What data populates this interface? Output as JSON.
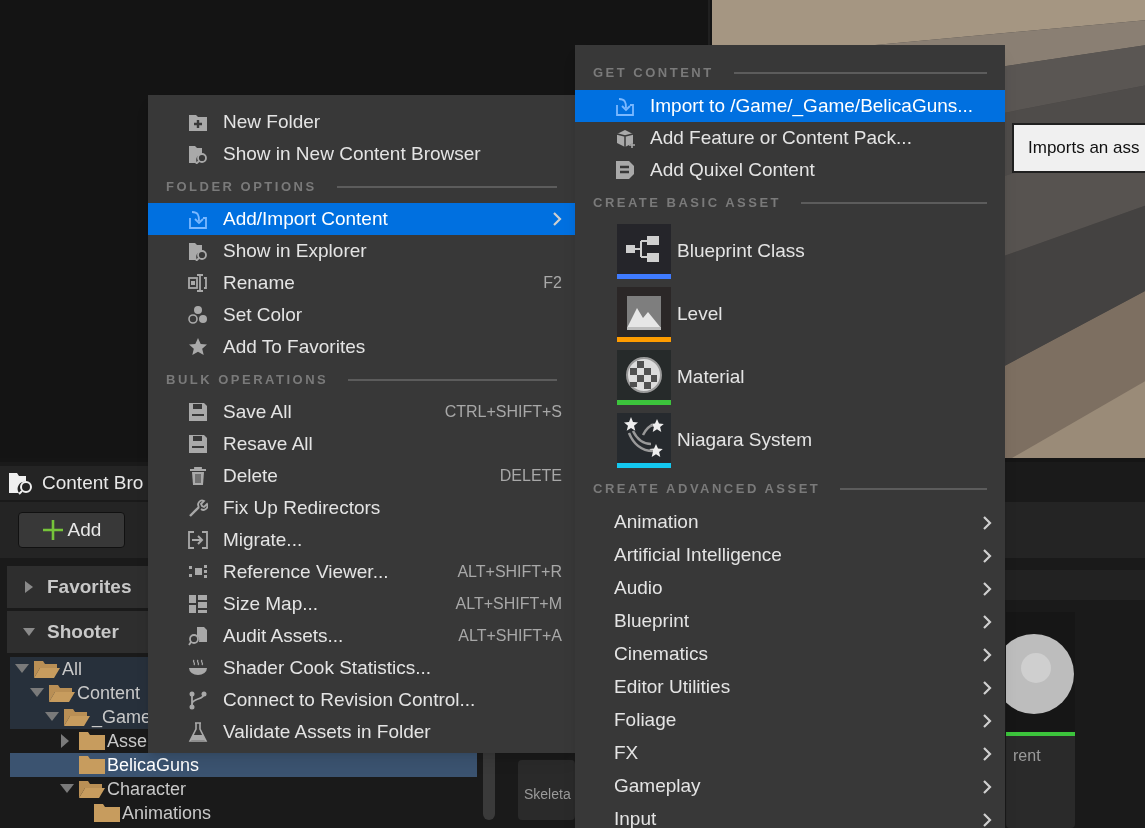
{
  "tooltip": {
    "text": "Imports an ass"
  },
  "content_browser": {
    "tab_title": "Content Bro",
    "add_button": "Add",
    "sections": [
      {
        "label": "Favorites",
        "expanded": false
      },
      {
        "label": "Shooter",
        "expanded": true
      }
    ],
    "tree": [
      {
        "label": "All",
        "expanded": true,
        "highlighted": true,
        "selected": false,
        "children": [
          {
            "label": "Content",
            "expanded": true,
            "highlighted": true,
            "selected": false,
            "children": [
              {
                "label": "_Game",
                "expanded": true,
                "highlighted": true,
                "selected": false,
                "children": [
                  {
                    "label": "Asse",
                    "expanded": false,
                    "highlighted": false,
                    "selected": false
                  },
                  {
                    "label": "BelicaGuns",
                    "highlighted": false,
                    "selected": true
                  },
                  {
                    "label": "Character",
                    "expanded": true,
                    "highlighted": false,
                    "selected": false,
                    "children": [
                      {
                        "label": "Animations",
                        "highlighted": false,
                        "selected": false
                      }
                    ]
                  }
                ]
              }
            ]
          }
        ]
      }
    ],
    "tiles": [
      {
        "label": "Skeleta"
      },
      {
        "label": "rent",
        "color": "#3cc43c"
      }
    ]
  },
  "context_menu": {
    "entries": [
      {
        "kind": "item",
        "label": "New Folder",
        "selected": false,
        "has_submenu": false
      },
      {
        "kind": "item",
        "label": "Show in New Content Browser",
        "selected": false,
        "has_submenu": false
      },
      {
        "kind": "header",
        "label": "FOLDER OPTIONS"
      },
      {
        "kind": "item",
        "label": "Add/Import Content",
        "selected": true,
        "has_submenu": true
      },
      {
        "kind": "item",
        "label": "Show in Explorer",
        "selected": false,
        "has_submenu": false
      },
      {
        "kind": "item",
        "label": "Rename",
        "shortcut": "F2",
        "selected": false,
        "has_submenu": false
      },
      {
        "kind": "item",
        "label": "Set Color",
        "selected": false,
        "has_submenu": false
      },
      {
        "kind": "item",
        "label": "Add To Favorites",
        "selected": false,
        "has_submenu": false
      },
      {
        "kind": "header",
        "label": "BULK OPERATIONS"
      },
      {
        "kind": "item",
        "label": "Save All",
        "shortcut": "CTRL+SHIFT+S",
        "selected": false,
        "has_submenu": false
      },
      {
        "kind": "item",
        "label": "Resave All",
        "selected": false,
        "has_submenu": false
      },
      {
        "kind": "item",
        "label": "Delete",
        "shortcut": "DELETE",
        "selected": false,
        "has_submenu": false
      },
      {
        "kind": "item",
        "label": "Fix Up Redirectors",
        "selected": false,
        "has_submenu": false
      },
      {
        "kind": "item",
        "label": "Migrate...",
        "selected": false,
        "has_submenu": false
      },
      {
        "kind": "item",
        "label": "Reference Viewer...",
        "shortcut": "ALT+SHIFT+R",
        "selected": false,
        "has_submenu": false
      },
      {
        "kind": "item",
        "label": "Size Map...",
        "shortcut": "ALT+SHIFT+M",
        "selected": false,
        "has_submenu": false
      },
      {
        "kind": "item",
        "label": "Audit Assets...",
        "shortcut": "ALT+SHIFT+A",
        "selected": false,
        "has_submenu": false
      },
      {
        "kind": "item",
        "label": "Shader Cook Statistics...",
        "selected": false,
        "has_submenu": false
      },
      {
        "kind": "item",
        "label": "Connect to Revision Control...",
        "selected": false,
        "has_submenu": false
      },
      {
        "kind": "item",
        "label": "Validate Assets in Folder",
        "selected": false,
        "has_submenu": false
      }
    ]
  },
  "submenu": {
    "entries": [
      {
        "kind": "header",
        "label": "GET CONTENT"
      },
      {
        "kind": "item",
        "label": "Import to /Game/_Game/BelicaGuns...",
        "selected": true
      },
      {
        "kind": "item",
        "label": "Add Feature or Content Pack...",
        "selected": false
      },
      {
        "kind": "item",
        "label": "Add Quixel Content",
        "selected": false
      },
      {
        "kind": "header",
        "label": "CREATE BASIC ASSET"
      },
      {
        "kind": "asset",
        "label": "Blueprint Class",
        "color": "#3f7bff"
      },
      {
        "kind": "asset",
        "label": "Level",
        "color": "#ff9c00"
      },
      {
        "kind": "asset",
        "label": "Material",
        "color": "#3cc43c"
      },
      {
        "kind": "asset",
        "label": "Niagara System",
        "color": "#14c8f0"
      },
      {
        "kind": "header",
        "label": "CREATE ADVANCED ASSET"
      },
      {
        "kind": "category",
        "label": "Animation"
      },
      {
        "kind": "category",
        "label": "Artificial Intelligence"
      },
      {
        "kind": "category",
        "label": "Audio"
      },
      {
        "kind": "category",
        "label": "Blueprint"
      },
      {
        "kind": "category",
        "label": "Cinematics"
      },
      {
        "kind": "category",
        "label": "Editor Utilities"
      },
      {
        "kind": "category",
        "label": "Foliage"
      },
      {
        "kind": "category",
        "label": "FX"
      },
      {
        "kind": "category",
        "label": "Gameplay"
      },
      {
        "kind": "category",
        "label": "Input"
      }
    ]
  }
}
